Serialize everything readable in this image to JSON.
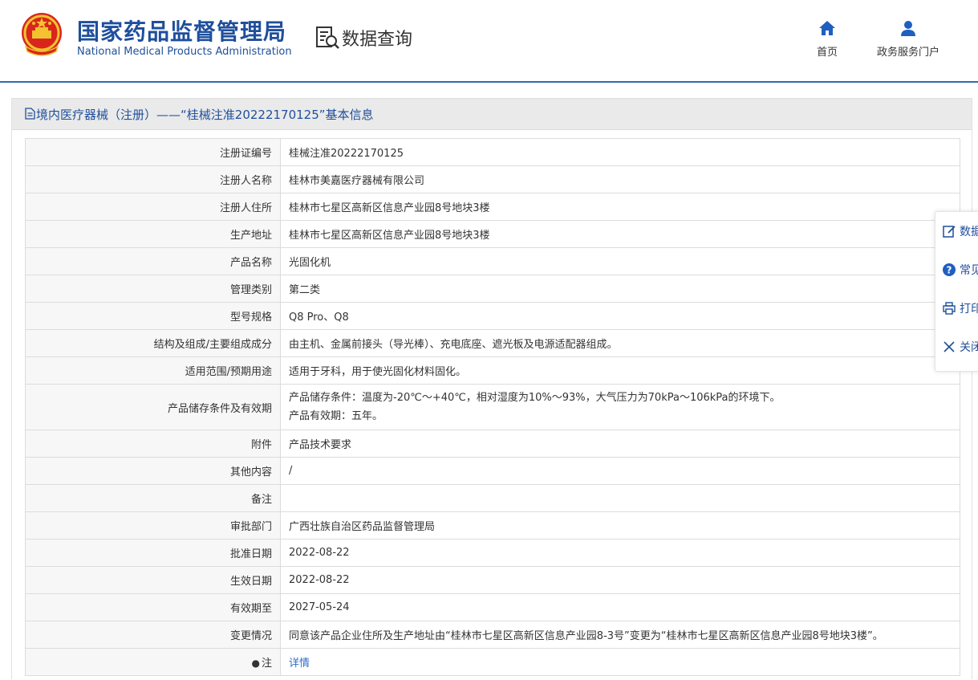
{
  "header": {
    "logo_cn": "国家药品监督管理局",
    "logo_en": "National Medical Products Administration",
    "query_title": "数据查询",
    "nav": {
      "home": "首页",
      "portal": "政务服务门户"
    }
  },
  "panel": {
    "title": "境内医疗器械（注册）——“桂械注准20222170125”基本信息"
  },
  "rows": [
    {
      "label": "注册证编号",
      "value": "桂械注准20222170125"
    },
    {
      "label": "注册人名称",
      "value": "桂林市美嘉医疗器械有限公司"
    },
    {
      "label": "注册人住所",
      "value": "桂林市七星区高新区信息产业园8号地块3楼"
    },
    {
      "label": "生产地址",
      "value": "桂林市七星区高新区信息产业园8号地块3楼"
    },
    {
      "label": "产品名称",
      "value": "光固化机"
    },
    {
      "label": "管理类别",
      "value": "第二类"
    },
    {
      "label": "型号规格",
      "value": "Q8 Pro、Q8"
    },
    {
      "label": "结构及组成/主要组成成分",
      "value": "由主机、金属前接头（导光棒）、充电底座、遮光板及电源适配器组成。"
    },
    {
      "label": "适用范围/预期用途",
      "value": "适用于牙科，用于使光固化材料固化。"
    },
    {
      "label": "产品储存条件及有效期",
      "value_line1": "产品储存条件：温度为-20℃～+40℃，相对湿度为10%～93%，大气压力为70kPa～106kPa的环境下。",
      "value_line2": "产品有效期：五年。"
    },
    {
      "label": "附件",
      "value": "产品技术要求"
    },
    {
      "label": "其他内容",
      "value": "/"
    },
    {
      "label": "备注",
      "value": ""
    },
    {
      "label": "审批部门",
      "value": "广西壮族自治区药品监督管理局"
    },
    {
      "label": "批准日期",
      "value": "2022-08-22"
    },
    {
      "label": "生效日期",
      "value": "2022-08-22"
    },
    {
      "label": "有效期至",
      "value": "2027-05-24"
    },
    {
      "label": "变更情况",
      "value": "同意该产品企业住所及生产地址由“桂林市七星区高新区信息产业园8-3号”变更为“桂林市七星区高新区信息产业园8号地块3楼”。"
    },
    {
      "label": "注",
      "value": "详情"
    }
  ],
  "float_bar": {
    "items": [
      "数据",
      "常见",
      "打印",
      "关闭"
    ]
  },
  "colors": {
    "brand_blue": "#1f4f9c",
    "header_line": "#2f6bb5",
    "link": "#2a6fc9"
  },
  "icons": {
    "emblem": "national-emblem-icon",
    "query": "document-search-icon",
    "home": "home-icon",
    "portal": "user-icon",
    "panel": "document-icon",
    "note": "pin-icon",
    "float": [
      "edit-icon",
      "question-icon",
      "print-icon",
      "close-icon"
    ]
  }
}
